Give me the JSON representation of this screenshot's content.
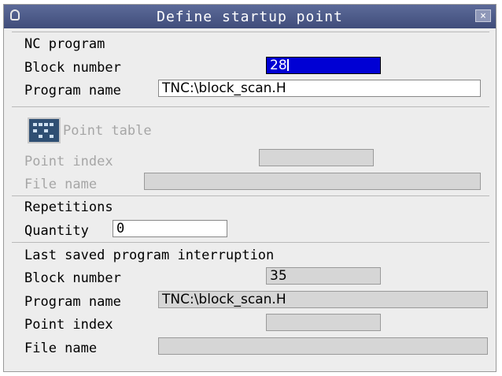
{
  "window": {
    "title": "Define startup point",
    "close_label": "×"
  },
  "nc_program": {
    "heading": "NC program",
    "block_number_label": "Block number",
    "block_number_value": "28",
    "program_name_label": "Program name",
    "program_name_value": "TNC:\\block_scan.H"
  },
  "point_table": {
    "button_label": "Point table",
    "icon": "point-table-icon",
    "point_index_label": "Point index",
    "point_index_value": "",
    "file_name_label": "File name",
    "file_name_value": ""
  },
  "repetitions": {
    "heading": "Repetitions",
    "quantity_label": "Quantity",
    "quantity_value": "0"
  },
  "last_saved": {
    "heading": "Last saved program interruption",
    "block_number_label": "Block number",
    "block_number_value": "35",
    "program_name_label": "Program name",
    "program_name_value": "TNC:\\block_scan.H",
    "point_index_label": "Point index",
    "point_index_value": "",
    "file_name_label": "File name",
    "file_name_value": ""
  },
  "colors": {
    "titlebar": "#4a578a",
    "active_field": "#0000d4",
    "disabled_text": "#a6a6a6"
  }
}
